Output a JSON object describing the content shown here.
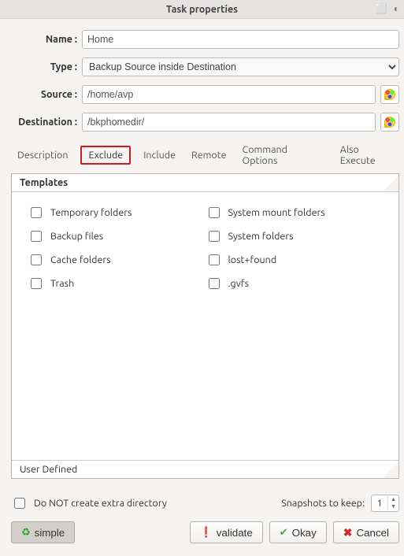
{
  "window": {
    "title": "Task properties"
  },
  "fields": {
    "name_label": "Name :",
    "name_value": "Home",
    "type_label": "Type :",
    "type_value": "Backup Source inside Destination",
    "source_label": "Source :",
    "source_value": "/home/avp",
    "dest_label": "Destination :",
    "dest_value": "/bkphomedir/"
  },
  "tabs": {
    "description": "Description",
    "exclude": "Exclude",
    "include": "Include",
    "remote": "Remote",
    "command_options": "Command Options",
    "also_execute": "Also Execute"
  },
  "templates": {
    "heading": "Templates",
    "left": [
      "Temporary folders",
      "Backup files",
      "Cache folders",
      "Trash"
    ],
    "right": [
      "System mount folders",
      "System folders",
      "lost+found",
      ".gvfs"
    ],
    "user_defined": "User Defined"
  },
  "bottom": {
    "no_extra_dir": "Do NOT create extra directory",
    "snapshots_label": "Snapshots to keep:",
    "snapshots_value": "1"
  },
  "buttons": {
    "simple": "simple",
    "validate": "validate",
    "okay": "Okay",
    "cancel": "Cancel"
  }
}
